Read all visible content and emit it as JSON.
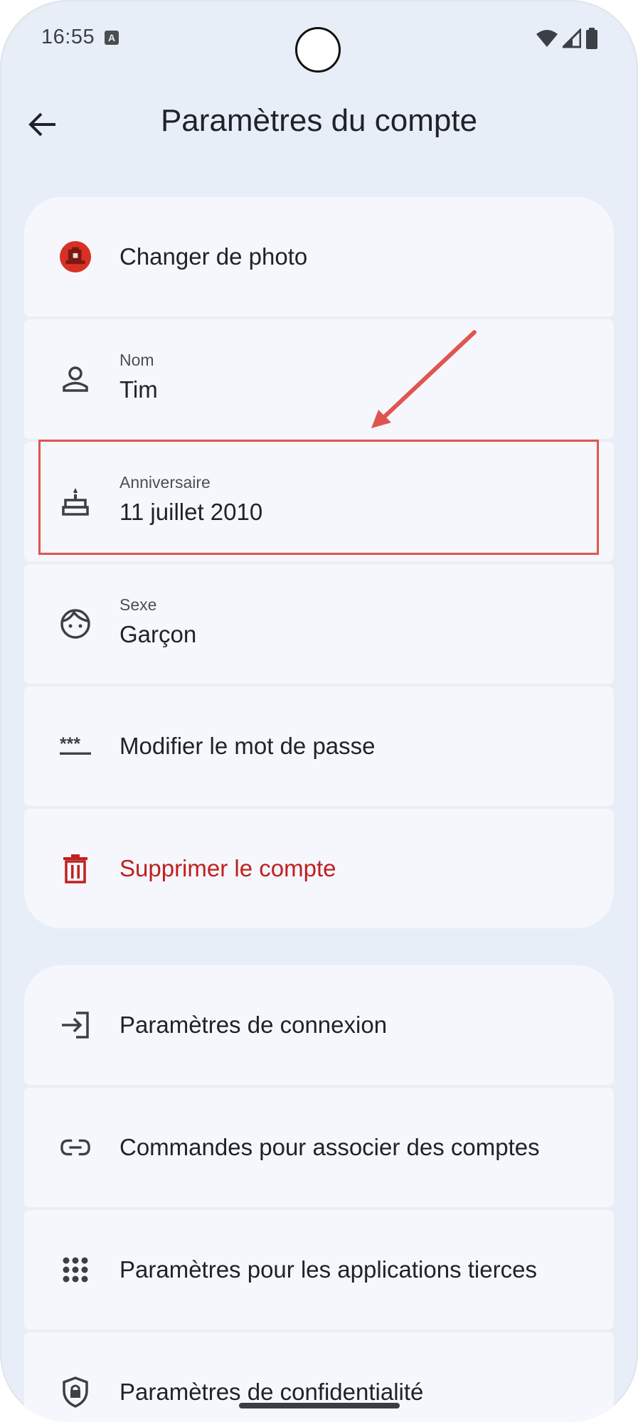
{
  "status_bar": {
    "time": "16:55",
    "notification_icon": "A"
  },
  "header": {
    "back_icon": "arrow-back-icon",
    "title": "Paramètres du compte"
  },
  "account_items": [
    {
      "icon": "avatar-icon",
      "label": "Changer de photo"
    },
    {
      "icon": "person-icon",
      "caption": "Nom",
      "value": "Tim"
    },
    {
      "icon": "cake-icon",
      "caption": "Anniversaire",
      "value": "11 juillet 2010"
    },
    {
      "icon": "face-icon",
      "caption": "Sexe",
      "value": "Garçon"
    },
    {
      "icon": "password-icon",
      "label": "Modifier le mot de passe"
    },
    {
      "icon": "trash-icon",
      "label": "Supprimer le compte"
    }
  ],
  "settings_items": [
    {
      "icon": "login-icon",
      "label": "Paramètres de connexion"
    },
    {
      "icon": "link-icon",
      "label": "Commandes pour associer des comptes"
    },
    {
      "icon": "apps-grid-icon",
      "label": "Paramètres pour les applications tierces"
    },
    {
      "icon": "shield-lock-icon",
      "label": "Paramètres de confidentialité"
    }
  ],
  "colors": {
    "background": "#e8eef8",
    "card": "#f5f7fc",
    "danger": "#c0201f",
    "annotation": "#e0554f"
  }
}
